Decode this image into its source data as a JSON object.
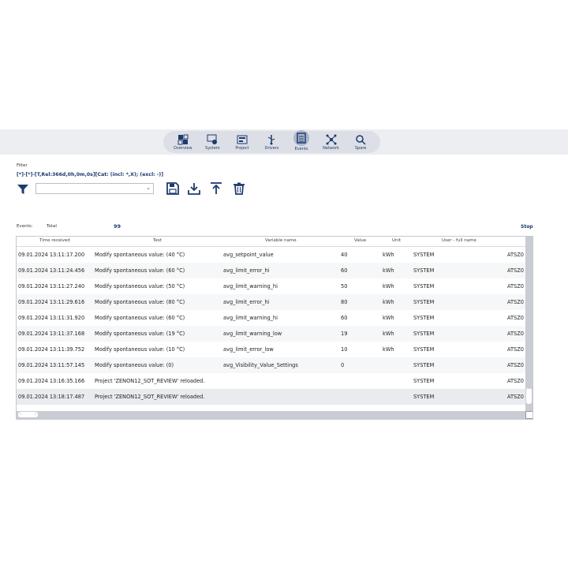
{
  "nav": {
    "items": [
      {
        "label": "Overview"
      },
      {
        "label": "System"
      },
      {
        "label": "Project"
      },
      {
        "label": "Drivers"
      },
      {
        "label": "Events"
      },
      {
        "label": "Network"
      },
      {
        "label": "Spare"
      }
    ],
    "active": "Events",
    "accent": "#1e3a6e"
  },
  "filter": {
    "label": "Filter",
    "expression": "[*]-[*]-[T,Rel:366d,0h,0m,0s][Cat: (incl: *,X); (excl: -)]",
    "combo_value": ""
  },
  "toolbar": {
    "icons": [
      "filter-icon",
      "save-icon",
      "download-icon",
      "upload-icon",
      "delete-icon"
    ]
  },
  "summary": {
    "events_label": "Events:",
    "total_label": "Total",
    "total_value": "99",
    "stop_label": "Stop"
  },
  "grid": {
    "columns": [
      "Time received",
      "Text",
      "Variable name",
      "Value",
      "Unit",
      "User - full name"
    ],
    "rows": [
      {
        "time": "09.01.2024 13:11:17.200",
        "text": "Modify spontaneous value: (40 °C)",
        "var": "avg_setpoint_value",
        "value": "40",
        "unit": "kWh",
        "user": "SYSTEM",
        "extra": "ATSZ0"
      },
      {
        "time": "09.01.2024 13:11:24.456",
        "text": "Modify spontaneous value: (60 °C)",
        "var": "avg_limit_error_hi",
        "value": "60",
        "unit": "kWh",
        "user": "SYSTEM",
        "extra": "ATSZ0"
      },
      {
        "time": "09.01.2024 13:11:27.240",
        "text": "Modify spontaneous value: (50 °C)",
        "var": "avg_limit_warning_hi",
        "value": "50",
        "unit": "kWh",
        "user": "SYSTEM",
        "extra": "ATSZ0"
      },
      {
        "time": "09.01.2024 13:11:29.616",
        "text": "Modify spontaneous value: (80 °C)",
        "var": "avg_limit_error_hi",
        "value": "80",
        "unit": "kWh",
        "user": "SYSTEM",
        "extra": "ATSZ0"
      },
      {
        "time": "09.01.2024 13:11:31.920",
        "text": "Modify spontaneous value: (60 °C)",
        "var": "avg_limit_warning_hi",
        "value": "60",
        "unit": "kWh",
        "user": "SYSTEM",
        "extra": "ATSZ0"
      },
      {
        "time": "09.01.2024 13:11:37.168",
        "text": "Modify spontaneous value: (19 °C)",
        "var": "avg_limit_warning_low",
        "value": "19",
        "unit": "kWh",
        "user": "SYSTEM",
        "extra": "ATSZ0"
      },
      {
        "time": "09.01.2024 13:11:39.752",
        "text": "Modify spontaneous value: (10 °C)",
        "var": "avg_limit_error_low",
        "value": "10",
        "unit": "kWh",
        "user": "SYSTEM",
        "extra": "ATSZ0"
      },
      {
        "time": "09.01.2024 13:11:57.145",
        "text": "Modify spontaneous value: (0)",
        "var": "avg_Visibility_Value_Settings",
        "value": "0",
        "unit": "",
        "user": "SYSTEM",
        "extra": "ATSZ0"
      },
      {
        "time": "09.01.2024 13:16:35.166",
        "text": "Project 'ZENON12_SOT_REVIEW' reloaded.",
        "var": "",
        "value": "",
        "unit": "",
        "user": "SYSTEM",
        "extra": "ATSZ0"
      },
      {
        "time": "09.01.2024 13:18:17.487",
        "text": "Project 'ZENON12_SOT_REVIEW' reloaded.",
        "var": "",
        "value": "",
        "unit": "",
        "user": "SYSTEM",
        "extra": "ATSZ0"
      }
    ]
  }
}
